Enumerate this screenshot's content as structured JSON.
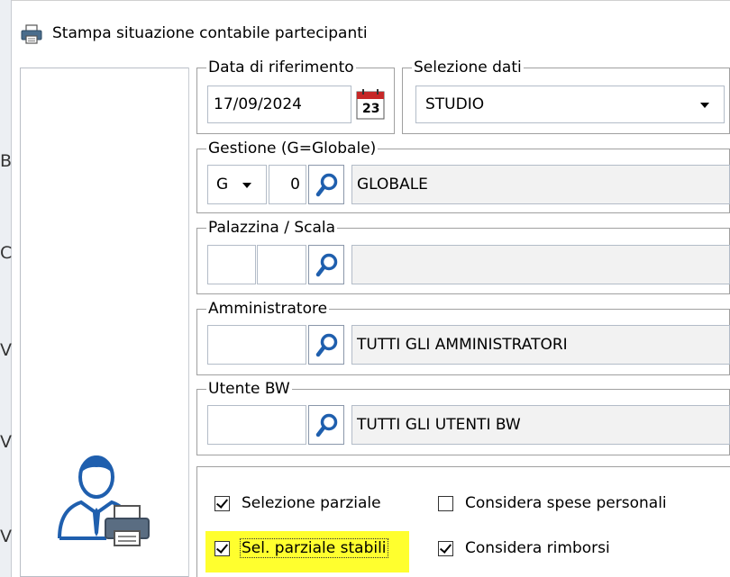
{
  "window": {
    "title": "Stampa situazione contabile partecipanti"
  },
  "left_edge_chars": [
    "B",
    "C",
    "V",
    "V",
    "V"
  ],
  "data_riferimento": {
    "legend": "Data di riferimento",
    "value": "17/09/2024",
    "calendar_day": "23"
  },
  "selezione_dati": {
    "legend": "Selezione dati",
    "value": "STUDIO"
  },
  "gestione": {
    "legend": "Gestione (G=Globale)",
    "type": "G",
    "code": "0",
    "description": "GLOBALE"
  },
  "palazzina": {
    "legend": "Palazzina / Scala",
    "code1": "",
    "code2": "",
    "description": ""
  },
  "amministratore": {
    "legend": "Amministratore",
    "code": "",
    "description": "TUTTI GLI AMMINISTRATORI"
  },
  "utente_bw": {
    "legend": "Utente BW",
    "code": "",
    "description": "TUTTI GLI UTENTI BW"
  },
  "options": {
    "selezione_parziale": {
      "label": "Selezione parziale",
      "checked": true
    },
    "considera_spese": {
      "label": "Considera spese personali",
      "checked": false
    },
    "sel_parziale_stabili": {
      "label": "Sel. parziale stabili",
      "checked": true
    },
    "considera_rimborsi": {
      "label": "Considera rimborsi",
      "checked": true
    }
  },
  "colors": {
    "highlight": "#ffff2e",
    "accent_blue": "#1f5fae",
    "calendar_red": "#c62828"
  }
}
